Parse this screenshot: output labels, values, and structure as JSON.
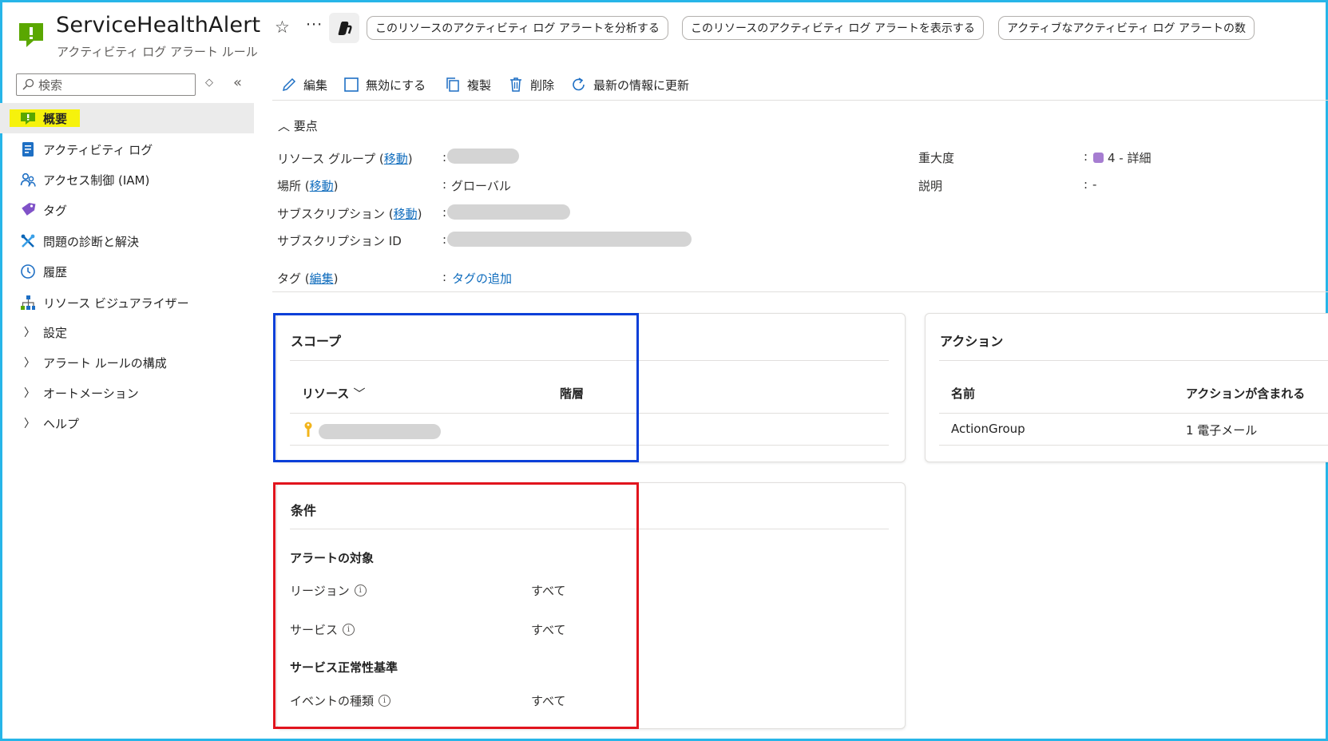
{
  "header": {
    "title": "ServiceHealthAlert",
    "subtitle": "アクティビティ ログ アラート ルール",
    "favorite_icon": "star-icon",
    "more_icon": "more-icon",
    "copilot_icon": "copilot-icon",
    "actions": [
      "このリソースのアクティビティ ログ アラートを分析する",
      "このリソースのアクティビティ ログ アラートを表示する",
      "アクティブなアクティビティ ログ アラートの数"
    ]
  },
  "sidebar": {
    "search_placeholder": "検索",
    "items": [
      {
        "label": "概要",
        "icon": "alert-rule-icon",
        "active": true
      },
      {
        "label": "アクティビティ ログ",
        "icon": "activity-log-icon"
      },
      {
        "label": "アクセス制御 (IAM)",
        "icon": "people-icon"
      },
      {
        "label": "タグ",
        "icon": "tag-icon"
      },
      {
        "label": "問題の診断と解決",
        "icon": "wrench-icon"
      },
      {
        "label": "履歴",
        "icon": "clock-icon"
      },
      {
        "label": "リソース ビジュアライザー",
        "icon": "hierarchy-icon"
      },
      {
        "label": "設定",
        "expandable": true
      },
      {
        "label": "アラート ルールの構成",
        "expandable": true
      },
      {
        "label": "オートメーション",
        "expandable": true
      },
      {
        "label": "ヘルプ",
        "expandable": true
      }
    ]
  },
  "toolbar": {
    "edit": "編集",
    "disable": "無効にする",
    "copy": "複製",
    "delete": "削除",
    "refresh": "最新の情報に更新"
  },
  "essentials": {
    "toggle": "要点",
    "resource_group_label": "リソース グループ",
    "move": "移動",
    "location_label": "場所",
    "location_value": "グローバル",
    "subscription_label": "サブスクリプション",
    "subscription_id_label": "サブスクリプション ID",
    "tags_label": "タグ",
    "tags_edit": "編集",
    "tags_add": "タグの追加",
    "severity_label": "重大度",
    "severity_value": "4 - 詳細",
    "description_label": "説明",
    "description_value": "-",
    "colon": ":",
    "severity_color": "#a67dd1"
  },
  "scope": {
    "title": "スコープ",
    "col_resource": "リソース",
    "col_level": "階層"
  },
  "actions": {
    "title": "アクション",
    "col_name": "名前",
    "col_actions": "アクションが含まれる",
    "row_name": "ActionGroup",
    "row_actions": "1 電子メール"
  },
  "condition": {
    "title": "条件",
    "target_heading": "アラートの対象",
    "region_label": "リージョン",
    "region_value": "すべて",
    "service_label": "サービス",
    "service_value": "すべて",
    "criteria_heading": "サービス正常性基準",
    "event_type_label": "イベントの種類",
    "event_type_value": "すべて"
  },
  "colors": {
    "frame": "#27b5e8",
    "scope_highlight": "#0a3fd8",
    "condition_highlight": "#e1141d",
    "active_highlight": "#f6f20c",
    "link": "#0f6cbd"
  }
}
